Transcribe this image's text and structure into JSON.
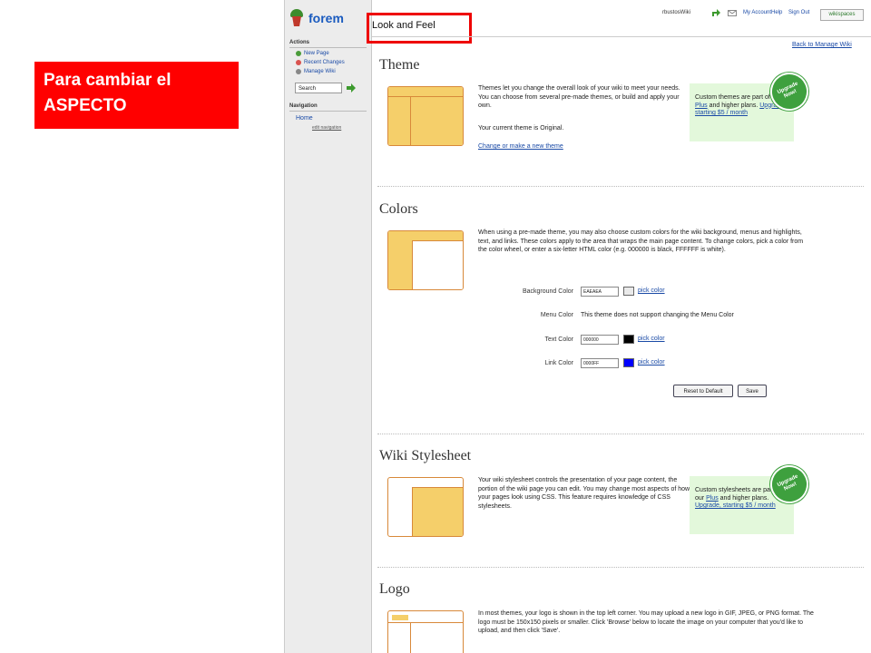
{
  "callout": {
    "text": "Para cambiar el ASPECTO"
  },
  "app": {
    "name": "forem"
  },
  "sidebar": {
    "actions_heading": "Actions",
    "actions": [
      {
        "label": "New Page"
      },
      {
        "label": "Recent Changes"
      },
      {
        "label": "Manage Wiki"
      }
    ],
    "search_value": "Search",
    "nav_heading": "Navigation",
    "nav": [
      {
        "label": "Home"
      },
      {
        "label": "edit navigation"
      }
    ]
  },
  "topbar": {
    "user": "rbustosWiki",
    "my_account": "My Account",
    "help": "Help",
    "sign_out": "Sign Out",
    "brand": "wikispaces"
  },
  "page": {
    "title": "Look and Feel",
    "back_link": "Back to Manage Wiki"
  },
  "theme": {
    "heading": "Theme",
    "text": "Themes let you change the overall look of your wiki to meet your needs. You can choose from several pre-made themes, or build and apply your own.",
    "current": "Your current theme is Original.",
    "link": "Change or make a new theme",
    "upgrade_text": "Custom themes are part of our",
    "upgrade_link1": "Plus",
    "upgrade_text2": "and higher plans.",
    "upgrade_link2": "Upgrade, starting $5 / month",
    "badge": "Upgrade Now!"
  },
  "colors": {
    "heading": "Colors",
    "text": "When using a pre-made theme, you may also choose custom colors for the wiki background, menus and highlights, text, and links. These colors apply to the area that wraps the main page content. To change colors, pick a color from the color wheel, or enter a six-letter HTML color (e.g. 000000 is black, FFFFFF is white).",
    "fields": [
      {
        "label": "Background Color",
        "value": "EAEAEA",
        "swatch": "#eaeaea",
        "pick": "pick color"
      },
      {
        "label": "Menu Color",
        "note": "This theme does not support changing the Menu Color"
      },
      {
        "label": "Text Color",
        "value": "000000",
        "swatch": "#000000",
        "pick": "pick color"
      },
      {
        "label": "Link Color",
        "value": "0000FF",
        "swatch": "#0000ff",
        "pick": "pick color"
      }
    ],
    "reset": "Reset to Default",
    "save": "Save"
  },
  "stylesheet": {
    "heading": "Wiki Stylesheet",
    "text": "Your wiki stylesheet controls the presentation of your page content, the portion of the wiki page you can edit. You may change most aspects of how your pages look using CSS. This feature requires knowledge of CSS stylesheets.",
    "upgrade_text": "Custom stylesheets are part of our",
    "upgrade_link1": "Plus",
    "upgrade_text2": "and higher plans.",
    "upgrade_link2": "Upgrade, starting $5 / month",
    "badge": "Upgrade Now!"
  },
  "logo": {
    "heading": "Logo",
    "text": "In most themes, your logo is shown in the top left corner. You may upload a new logo in GIF, JPEG, or PNG format. The logo must be 150x150 pixels or smaller. Click 'Browse' below to locate the image on your computer that you'd like to upload, and then click 'Save'."
  },
  "colors_palette": {
    "accent": "#f5cf6a",
    "border": "#d8893a",
    "link": "#1a4aa6",
    "upgrade_bg": "#e3f8db",
    "badge": "#3ea03e",
    "callout": "#ff0000"
  }
}
